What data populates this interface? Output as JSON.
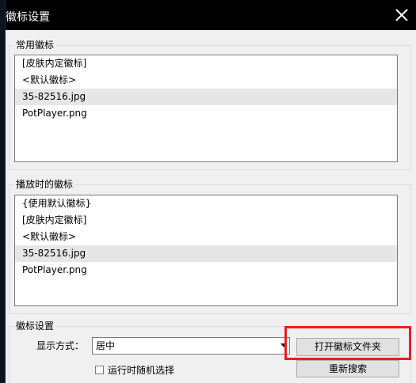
{
  "window": {
    "title": "徽标设置"
  },
  "common_logos": {
    "label": "常用徽标",
    "items": [
      {
        "text": "[皮肤内定徽标]",
        "selected": false
      },
      {
        "text": "<默认徽标>",
        "selected": false
      },
      {
        "text": "35-82516.jpg",
        "selected": true
      },
      {
        "text": "PotPlayer.png",
        "selected": false
      }
    ]
  },
  "playback_logos": {
    "label": "播放时的徽标",
    "items": [
      {
        "text": "{使用默认徽标}",
        "selected": false
      },
      {
        "text": "[皮肤内定徽标]",
        "selected": false
      },
      {
        "text": "<默认徽标>",
        "selected": false
      },
      {
        "text": "35-82516.jpg",
        "selected": true
      },
      {
        "text": "PotPlayer.png",
        "selected": false
      }
    ]
  },
  "logo_settings": {
    "label": "徽标设置",
    "display_mode_label": "显示方式：",
    "display_mode_value": "居中",
    "random_label": "运行时随机选择",
    "random_checked": false,
    "open_folder_label": "打开徽标文件夹",
    "rescan_label": "重新搜索"
  },
  "colors": {
    "titlebar": "#000000",
    "highlight": "#e8201e",
    "selected_row": "#e6e6e6"
  }
}
